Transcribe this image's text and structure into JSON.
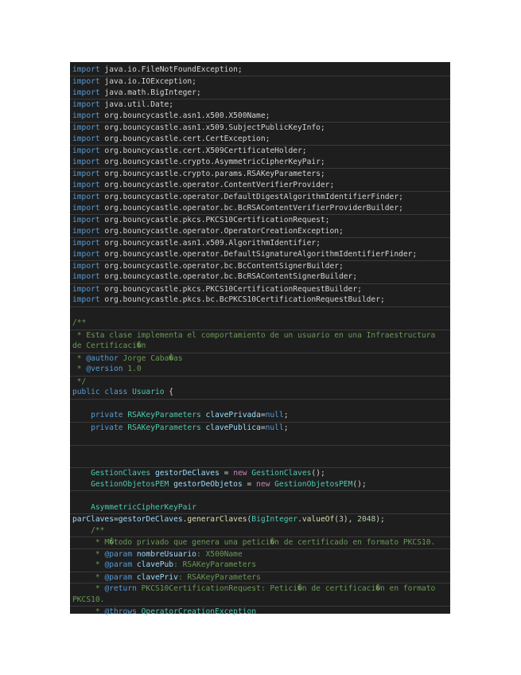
{
  "palette": {
    "kw": "#569cd6",
    "tx": "#d4d4d4",
    "cm": "#6a9955",
    "ty": "#4ec9b0",
    "va": "#9cdcfe",
    "nw": "#c586c0",
    "nu": "#b5cea8",
    "fn": "#dcdcaa",
    "bg": "#1e1e1e"
  },
  "lines": [
    [
      [
        "kw",
        "import"
      ],
      [
        "tx",
        " java.io.FileNotFoundException;"
      ]
    ],
    [
      [
        "kw",
        "import"
      ],
      [
        "tx",
        " java.io.IOException;"
      ]
    ],
    [
      [
        "kw",
        "import"
      ],
      [
        "tx",
        " java.math.BigInteger;"
      ]
    ],
    [
      [
        "kw",
        "import"
      ],
      [
        "tx",
        " java.util.Date;"
      ]
    ],
    [
      [
        "kw",
        "import"
      ],
      [
        "tx",
        " org.bouncycastle.asn1.x500.X500Name;"
      ]
    ],
    [
      [
        "kw",
        "import"
      ],
      [
        "tx",
        " org.bouncycastle.asn1.x509.SubjectPublicKeyInfo;"
      ]
    ],
    [
      [
        "kw",
        "import"
      ],
      [
        "tx",
        " org.bouncycastle.cert.CertException;"
      ]
    ],
    [
      [
        "kw",
        "import"
      ],
      [
        "tx",
        " org.bouncycastle.cert.X509CertificateHolder;"
      ]
    ],
    [
      [
        "kw",
        "import"
      ],
      [
        "tx",
        " org.bouncycastle.crypto.AsymmetricCipherKeyPair;"
      ]
    ],
    [
      [
        "kw",
        "import"
      ],
      [
        "tx",
        " org.bouncycastle.crypto.params.RSAKeyParameters;"
      ]
    ],
    [
      [
        "kw",
        "import"
      ],
      [
        "tx",
        " org.bouncycastle.operator.ContentVerifierProvider;"
      ]
    ],
    [
      [
        "kw",
        "import"
      ],
      [
        "tx",
        " org.bouncycastle.operator.DefaultDigestAlgorithmIdentifierFinder;"
      ]
    ],
    [
      [
        "kw",
        "import"
      ],
      [
        "tx",
        " org.bouncycastle.operator.bc.BcRSAContentVerifierProviderBuilder;"
      ]
    ],
    [
      [
        "kw",
        "import"
      ],
      [
        "tx",
        " org.bouncycastle.pkcs.PKCS10CertificationRequest;"
      ]
    ],
    [
      [
        "kw",
        "import"
      ],
      [
        "tx",
        " org.bouncycastle.operator.OperatorCreationException;"
      ]
    ],
    [
      [
        "kw",
        "import"
      ],
      [
        "tx",
        " org.bouncycastle.asn1.x509.AlgorithmIdentifier;"
      ]
    ],
    [
      [
        "kw",
        "import"
      ],
      [
        "tx",
        " org.bouncycastle.operator.DefaultSignatureAlgorithmIdentifierFinder;"
      ]
    ],
    [
      [
        "kw",
        "import"
      ],
      [
        "tx",
        " org.bouncycastle.operator.bc.BcContentSignerBuilder;"
      ]
    ],
    [
      [
        "kw",
        "import"
      ],
      [
        "tx",
        " org.bouncycastle.operator.bc.BcRSAContentSignerBuilder;"
      ]
    ],
    [
      [
        "kw",
        "import"
      ],
      [
        "tx",
        " org.bouncycastle.pkcs.PKCS10CertificationRequestBuilder;"
      ]
    ],
    [
      [
        "kw",
        "import"
      ],
      [
        "tx",
        " org.bouncycastle.pkcs.bc.BcPKCS10CertificationRequestBuilder;"
      ]
    ],
    [],
    [
      [
        "cm",
        "/**"
      ]
    ],
    [
      [
        "cm",
        " * Esta clase implementa el comportamiento de un usuario en una Infraestructura"
      ]
    ],
    [
      [
        "cm",
        "de Certificaci�n"
      ]
    ],
    [
      [
        "cm",
        " * "
      ],
      [
        "kw",
        "@author"
      ],
      [
        "cm",
        " Jorge Caba�as"
      ]
    ],
    [
      [
        "cm",
        " * "
      ],
      [
        "kw",
        "@version"
      ],
      [
        "cm",
        " 1.0"
      ]
    ],
    [
      [
        "cm",
        " */"
      ]
    ],
    [
      [
        "kw",
        "public class "
      ],
      [
        "ty",
        "Usuario"
      ],
      [
        "tx",
        " {"
      ]
    ],
    [],
    [
      [
        "tx",
        "    "
      ],
      [
        "kw",
        "private "
      ],
      [
        "ty",
        "RSAKeyParameters "
      ],
      [
        "va",
        "clavePrivada"
      ],
      [
        "tx",
        "="
      ],
      [
        "kw",
        "null"
      ],
      [
        "tx",
        ";"
      ]
    ],
    [
      [
        "tx",
        "    "
      ],
      [
        "kw",
        "private "
      ],
      [
        "ty",
        "RSAKeyParameters "
      ],
      [
        "va",
        "clavePublica"
      ],
      [
        "tx",
        "="
      ],
      [
        "kw",
        "null"
      ],
      [
        "tx",
        ";"
      ]
    ],
    [],
    [],
    [],
    [
      [
        "tx",
        "    "
      ],
      [
        "ty",
        "GestionClaves "
      ],
      [
        "va",
        "gestorDeClaves"
      ],
      [
        "tx",
        " = "
      ],
      [
        "nw",
        "new "
      ],
      [
        "ty",
        "GestionClaves"
      ],
      [
        "tx",
        "();"
      ]
    ],
    [
      [
        "tx",
        "    "
      ],
      [
        "ty",
        "GestionObjetosPEM "
      ],
      [
        "va",
        "gestorDeObjetos"
      ],
      [
        "tx",
        " = "
      ],
      [
        "nw",
        "new "
      ],
      [
        "ty",
        "GestionObjetosPEM"
      ],
      [
        "tx",
        "();"
      ]
    ],
    [],
    [
      [
        "tx",
        "    "
      ],
      [
        "ty",
        "AsymmetricCipherKeyPair"
      ]
    ],
    [
      [
        "va",
        "parClaves"
      ],
      [
        "tx",
        "="
      ],
      [
        "va",
        "gestorDeClaves"
      ],
      [
        "tx",
        "."
      ],
      [
        "fn",
        "generarClaves"
      ],
      [
        "tx",
        "("
      ],
      [
        "ty",
        "BigInteger"
      ],
      [
        "tx",
        "."
      ],
      [
        "fn",
        "valueOf"
      ],
      [
        "tx",
        "("
      ],
      [
        "nu",
        "3"
      ],
      [
        "tx",
        "), "
      ],
      [
        "nu",
        "2048"
      ],
      [
        "tx",
        ");"
      ]
    ],
    [
      [
        "cm",
        "    /**"
      ]
    ],
    [
      [
        "cm",
        "     * M�todo privado que genera una petici�n de certificado en formato PKCS10."
      ]
    ],
    [
      [
        "cm",
        "     * "
      ],
      [
        "kw",
        "@param "
      ],
      [
        "va",
        "nombreUsuario"
      ],
      [
        "cm",
        ": X500Name"
      ]
    ],
    [
      [
        "cm",
        "     * "
      ],
      [
        "kw",
        "@param "
      ],
      [
        "va",
        "clavePub"
      ],
      [
        "cm",
        ": RSAKeyParameters"
      ]
    ],
    [
      [
        "cm",
        "     * "
      ],
      [
        "kw",
        "@param "
      ],
      [
        "va",
        "clavePriv"
      ],
      [
        "cm",
        ": RSAKeyParameters"
      ]
    ],
    [
      [
        "cm",
        "     * "
      ],
      [
        "kw",
        "@return"
      ],
      [
        "cm",
        " PKCS10CertificationRequest: Petici�n de certificaci�n en formato"
      ]
    ],
    [
      [
        "cm",
        "PKCS10."
      ]
    ],
    [
      [
        "cm",
        "     * "
      ],
      [
        "kw",
        "@throws"
      ],
      [
        "ty",
        " OperatorCreationException"
      ]
    ]
  ]
}
